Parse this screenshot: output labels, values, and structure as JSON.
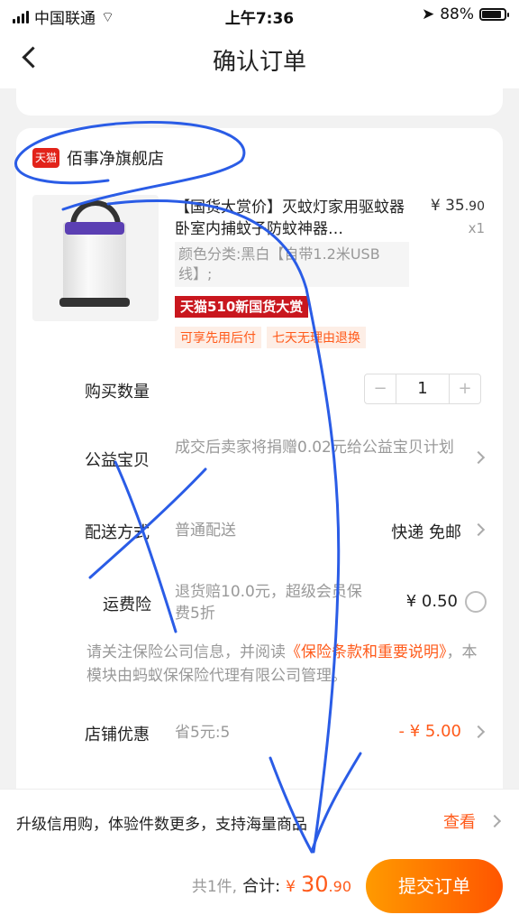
{
  "status_bar": {
    "carrier": "中国联通",
    "time": "上午7:36",
    "battery": "88%",
    "battery_level": 0.88
  },
  "nav": {
    "title": "确认订单"
  },
  "store": {
    "badge": "天猫",
    "name": "佰事净旗舰店"
  },
  "product": {
    "title": "【国货大赏价】灭蚊灯家用驱蚊器卧室内捕蚊子防蚊神器…",
    "price_main": "¥ 35",
    "price_decimal": ".90",
    "qty": "x1",
    "spec": "颜色分类:黑白【自带1.2米USB线】;",
    "promo": "天猫510新国货大赏",
    "tags": [
      "可享先用后付",
      "七天无理由退换"
    ]
  },
  "rows": {
    "quantity_label": "购买数量",
    "quantity_value": "1",
    "minus": "−",
    "plus": "+",
    "charity_label": "公益宝贝",
    "charity_text": "成交后卖家将捐赠0.02元给公益宝贝计划",
    "shipping_label": "配送方式",
    "shipping_text": "普通配送",
    "shipping_value": "快递 免邮",
    "insurance_label": "运费险",
    "insurance_text": "退货赔10.0元，超级会员保费5折",
    "insurance_value": "¥ 0.50",
    "notice_pre": "请关注保险公司信息，并阅读",
    "notice_link": "《保险条款和重要说明》",
    "notice_post": "，本模块由蚂蚁保保险代理有限公司管理。",
    "discount_label": "店铺优惠",
    "discount_text": "省5元:5",
    "discount_value": "- ¥ 5.00"
  },
  "bottom_tip": {
    "text": "升级信用购，体验件数更多，支持海量商品",
    "view": "查看"
  },
  "submit_bar": {
    "count": "共1件,",
    "sum_label": "合计:",
    "currency": "¥",
    "amount_main": "30",
    "amount_decimal": ".90",
    "submit": "提交订单"
  }
}
